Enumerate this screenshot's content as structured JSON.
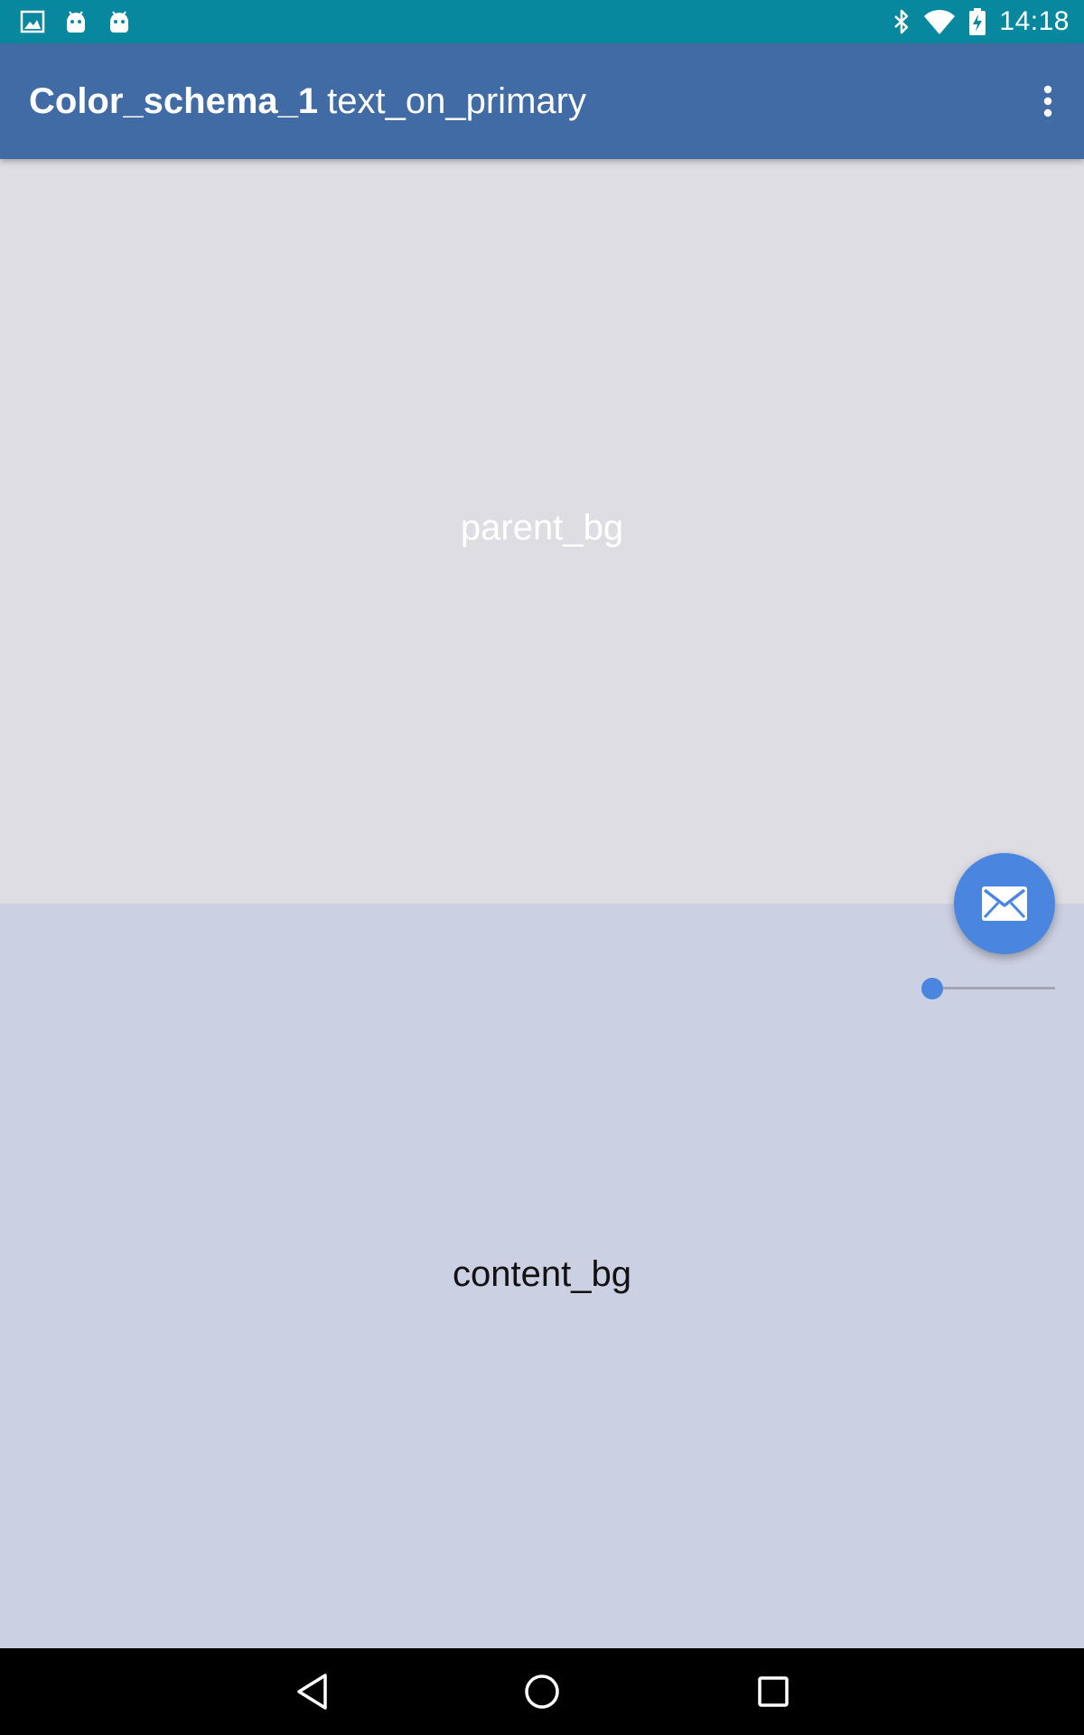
{
  "status_bar": {
    "time": "14:18",
    "left_icons": [
      "image-notification-icon",
      "android-notification-icon",
      "android-notification-icon"
    ],
    "right_icons": [
      "bluetooth-icon",
      "wifi-icon",
      "battery-charging-icon"
    ],
    "background_color": "#08889e"
  },
  "app_bar": {
    "title_bold": "Color_schema_1",
    "title_rest": "text_on_primary",
    "overflow_icon": "more-vert-icon",
    "background_color": "#416ba5"
  },
  "parent_panel": {
    "label": "parent_bg",
    "background_color": "#dfdde4"
  },
  "content_panel": {
    "label": "content_bg",
    "background_color": "#cbd0e3"
  },
  "slider": {
    "value": 0,
    "accent_color": "#4a86e0"
  },
  "fab": {
    "icon": "mail-icon",
    "color": "#4a86e0"
  },
  "nav_bar": {
    "buttons": [
      "back-icon",
      "home-icon",
      "recents-icon"
    ]
  }
}
